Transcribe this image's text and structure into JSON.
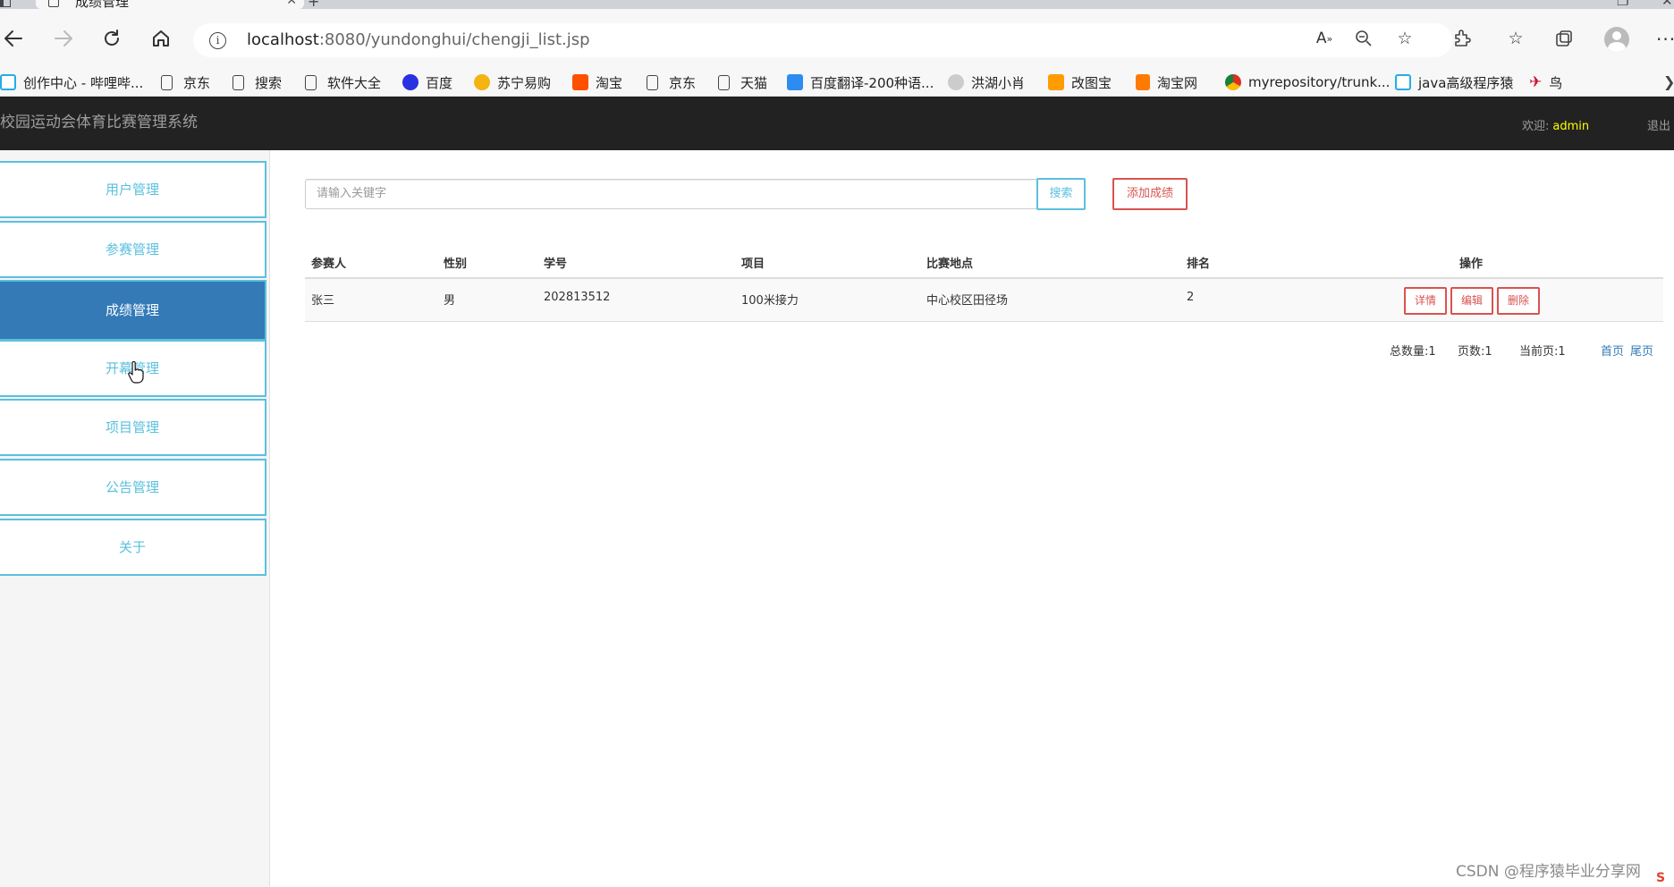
{
  "browser": {
    "tab_title": "成绩管理",
    "url_host": "localhost",
    "url_path": ":8080/yundonghui/chengji_list.jsp",
    "bookmarks": [
      {
        "label": "创作中心 - 哔哩哔...",
        "icon": "bilibili-icon"
      },
      {
        "label": "京东",
        "icon": "page-icon"
      },
      {
        "label": "搜索",
        "icon": "page-icon"
      },
      {
        "label": "软件大全",
        "icon": "page-icon"
      },
      {
        "label": "百度",
        "icon": "baidu-icon"
      },
      {
        "label": "苏宁易购",
        "icon": "suning-icon"
      },
      {
        "label": "淘宝",
        "icon": "taobao-icon"
      },
      {
        "label": "京东",
        "icon": "page-icon"
      },
      {
        "label": "天猫",
        "icon": "page-icon"
      },
      {
        "label": "百度翻译-200种语...",
        "icon": "translate-icon"
      },
      {
        "label": "洪湖小肖",
        "icon": "honghu-icon"
      },
      {
        "label": "改图宝",
        "icon": "gaitubao-icon"
      },
      {
        "label": "淘宝网",
        "icon": "taobao-icon"
      },
      {
        "label": "myrepository/trunk...",
        "icon": "chrome-icon"
      },
      {
        "label": "java高级程序猿",
        "icon": "bilibili-icon"
      },
      {
        "label": "鸟",
        "icon": "bird-icon"
      }
    ]
  },
  "app": {
    "brand": "校园运动会体育比赛管理系统",
    "welcome_label": "欢迎:",
    "username": "admin",
    "logout": "退出"
  },
  "sidebar": {
    "items": [
      {
        "label": "用户管理",
        "active": false
      },
      {
        "label": "参赛管理",
        "active": false
      },
      {
        "label": "成绩管理",
        "active": true
      },
      {
        "label": "开幕管理",
        "active": false
      },
      {
        "label": "项目管理",
        "active": false
      },
      {
        "label": "公告管理",
        "active": false
      },
      {
        "label": "关于",
        "active": false
      }
    ]
  },
  "search": {
    "placeholder": "请输入关键字",
    "button": "搜索",
    "add_button": "添加成绩"
  },
  "table": {
    "headers": [
      "参赛人",
      "性别",
      "学号",
      "项目",
      "比赛地点",
      "排名",
      "操作"
    ],
    "rows": [
      {
        "cells": [
          "张三",
          "男",
          "202813512",
          "100米接力",
          "中心校区田径场",
          "2"
        ],
        "actions": [
          "详情",
          "编辑",
          "删除"
        ]
      }
    ]
  },
  "pager": {
    "total": "总数量:1",
    "pages": "页数:1",
    "current": "当前页:1",
    "first": "首页",
    "last": "尾页"
  },
  "watermark": "CSDN @程序猿毕业分享网",
  "colors": {
    "header_bg": "#222222",
    "brand_text": "#9d9d9d",
    "username": "#ffff00",
    "info": "#5bc0de",
    "primary": "#337ab7",
    "danger": "#d9534f"
  }
}
